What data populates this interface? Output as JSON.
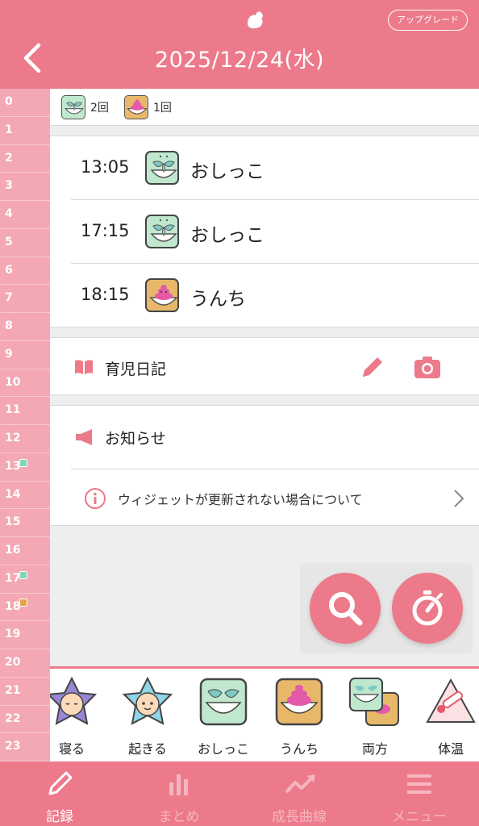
{
  "header": {
    "title": "2025/12/24(水)",
    "upgrade_label": "アップグレード",
    "back_icon": "chevron-left-icon",
    "logo_icon": "app-logo-icon"
  },
  "colors": {
    "primary": "#ec7a8a",
    "hour_strip": "#f3a8b4",
    "pee_icon_bg": "#bfe8cf",
    "poo_icon_bg": "#e8b86a",
    "poo_mark": "#e8a04a",
    "pee_mark": "#7fd6b5"
  },
  "hours": [
    "0",
    "1",
    "2",
    "3",
    "4",
    "5",
    "6",
    "7",
    "8",
    "9",
    "10",
    "11",
    "12",
    "13",
    "14",
    "15",
    "16",
    "17",
    "18",
    "19",
    "20",
    "21",
    "22",
    "23"
  ],
  "summary": {
    "pee_count": "2回",
    "poo_count": "1回"
  },
  "records": [
    {
      "time": "13:05",
      "label": "おしっこ",
      "icon": "pee-icon"
    },
    {
      "time": "17:15",
      "label": "おしっこ",
      "icon": "pee-icon"
    },
    {
      "time": "18:15",
      "label": "うんち",
      "icon": "poo-icon"
    }
  ],
  "diary": {
    "label": "育児日記",
    "edit_icon": "pencil-icon",
    "camera_icon": "camera-icon"
  },
  "news": {
    "title": "お知らせ",
    "item": "ウィジェットが更新されない場合について"
  },
  "quick": [
    {
      "label": "寝る",
      "icon": "sleep-icon"
    },
    {
      "label": "起きる",
      "icon": "wake-icon"
    },
    {
      "label": "おしっこ",
      "icon": "pee-icon"
    },
    {
      "label": "うんち",
      "icon": "poo-icon"
    },
    {
      "label": "両方",
      "icon": "both-icon"
    },
    {
      "label": "体温",
      "icon": "thermometer-icon"
    }
  ],
  "nav": [
    {
      "label": "記録",
      "icon": "pencil-icon"
    },
    {
      "label": "まとめ",
      "icon": "bar-chart-icon"
    },
    {
      "label": "成長曲線",
      "icon": "trend-up-icon"
    },
    {
      "label": "メニュー",
      "icon": "menu-icon"
    }
  ]
}
